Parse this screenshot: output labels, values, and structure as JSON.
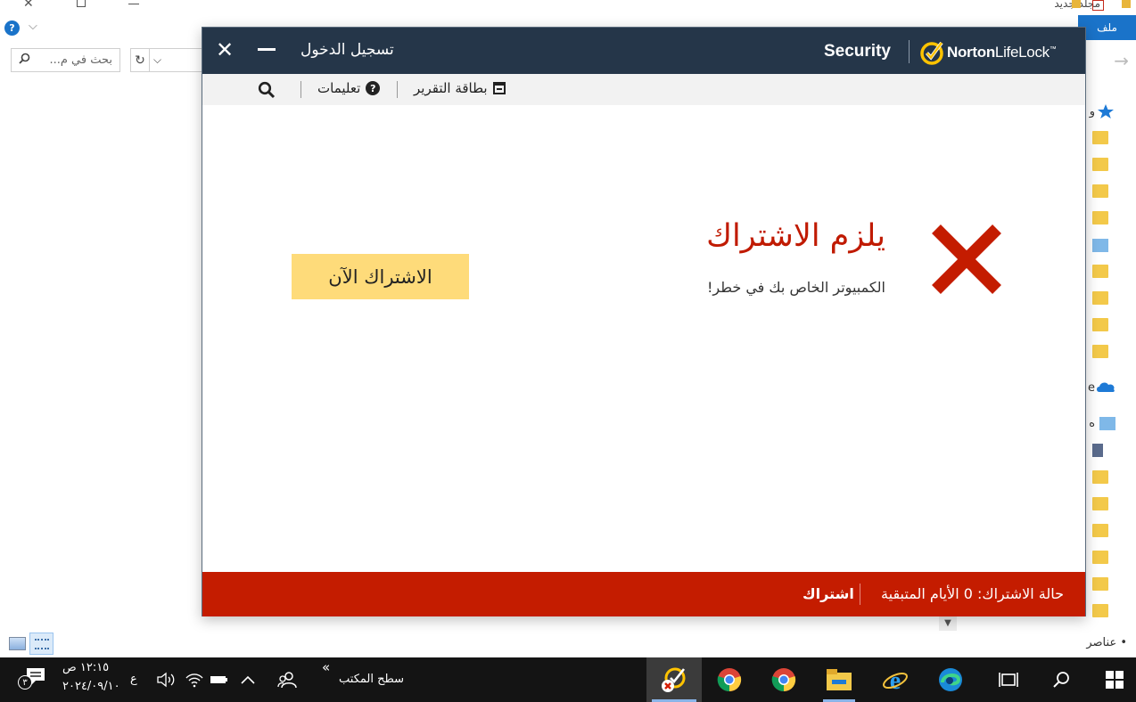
{
  "explorer": {
    "title": "مجلد جديد",
    "ribbon_file": "ملف",
    "search_placeholder": "بحث في م...",
    "help_icon": "?",
    "status_items": "• عناصر",
    "nav_cut_texts": [
      "و",
      "e",
      "ه"
    ]
  },
  "norton": {
    "header": {
      "signin": "تسجيل الدخول",
      "product": "Security",
      "logo_norton": "Norton",
      "logo_lifelock": "LifeLock"
    },
    "toolbar": {
      "report_card": "بطاقة التقرير",
      "help": "تعليمات"
    },
    "status": {
      "title": "يلزم الاشتراك",
      "subtitle": "الكمبيوتر الخاص بك في خطر!",
      "cta": "الاشتراك الآن"
    },
    "footer": {
      "status_label": "حالة الاشتراك:",
      "days_remaining": "0 الأيام المتبقية",
      "subscribe": "اشتراك"
    },
    "colors": {
      "header": "#253649",
      "error_red": "#c41c00",
      "cta_yellow": "#fedb7a",
      "logo_yellow": "#ffc300"
    }
  },
  "taskbar": {
    "time": "١٢:١٥ ص",
    "date": "٢٠٢٤/٠٩/١٠",
    "lang": "ع",
    "desktop": "سطح المكتب",
    "notif_count": "٣",
    "chevrons": "»",
    "apps": [
      "norton-icon",
      "chrome-icon",
      "chrome-icon",
      "file-explorer-icon",
      "internet-explorer-icon",
      "edge-icon",
      "task-view-icon",
      "search-icon",
      "windows-start-icon"
    ]
  }
}
